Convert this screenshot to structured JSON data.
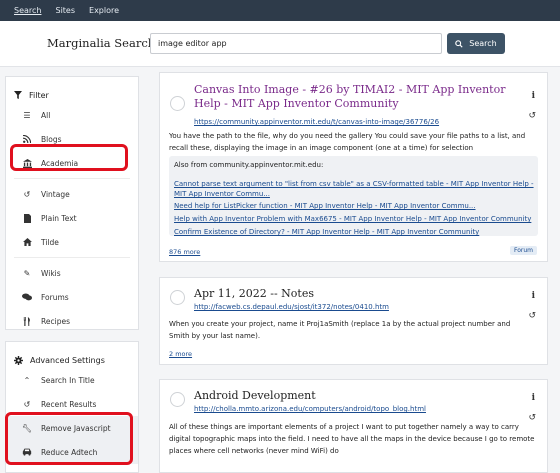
{
  "topnav": {
    "search": "Search",
    "sites": "Sites",
    "explore": "Explore"
  },
  "header": {
    "brand": "Marginalia Search",
    "query": "image editor app",
    "search_button": "Search"
  },
  "filter": {
    "title": "Filter",
    "items": [
      {
        "label": "All",
        "icon": "list-icon"
      },
      {
        "label": "Blogs",
        "icon": "rss-icon"
      },
      {
        "label": "Academia",
        "icon": "university-icon"
      },
      {
        "label": "Vintage",
        "icon": "history-icon"
      },
      {
        "label": "Plain Text",
        "icon": "file-icon"
      },
      {
        "label": "Tilde",
        "icon": "home-icon"
      },
      {
        "label": "Wikis",
        "icon": "pen-icon"
      },
      {
        "label": "Forums",
        "icon": "comments-icon"
      },
      {
        "label": "Recipes",
        "icon": "utensils-icon"
      }
    ]
  },
  "advanced": {
    "title": "Advanced Settings",
    "items": [
      {
        "label": "Search In Title",
        "icon": "caret-up-icon"
      },
      {
        "label": "Recent Results",
        "icon": "history-icon"
      },
      {
        "label": "Remove Javascript",
        "icon": "wrench-icon"
      },
      {
        "label": "Reduce Adtech",
        "icon": "car-icon"
      }
    ]
  },
  "results": [
    {
      "title": "Canvas Into Image - #26 by TIMAI2 - MIT App Inventor Help - MIT App Inventor Community",
      "url": "https://community.appinventor.mit.edu/t/canvas-into-image/36776/26",
      "description": "You have the path to the file, why do you need the gallery You could save your file paths to a list, and recall these, displaying the image in an image component (one at a time) for selection",
      "also_from": "Also from community.appinventor.mit.edu:",
      "also_links": [
        "Cannot parse text argument to \"list from csv table\" as a CSV-formatted table - MIT App Inventor Help - MIT App Inventor Commu...",
        "Need help for ListPicker function - MIT App Inventor Help - MIT App Inventor Commu...",
        "Help with App Inventor Problem with Max6675 - MIT App Inventor Help - MIT App Inventor Community",
        "Confirm Existence of Directory? - MIT App Inventor Help - MIT App Inventor Community"
      ],
      "more": "876 more",
      "tag": "Forum"
    },
    {
      "title": "Apr 11, 2022 -- Notes",
      "url": "http://facweb.cs.depaul.edu/sjost/it372/notes/0410.htm",
      "description": "When you create your project, name it Proj1aSmith (replace 1a by the actual project number and Smith by your last name).",
      "more": "2 more"
    },
    {
      "title": "Android Development",
      "url": "http://cholla.mmto.arizona.edu/computers/android/topo_blog.html",
      "description": "All of these things are important elements of a project I want to put together namely a way to carry digital topographic maps into the field. I need to have all the maps in the device because I go to remote places where cell networks (never mind WiFi) do"
    }
  ],
  "colors": {
    "nav_bg": "#2e3b4a",
    "button_bg": "#3d5366",
    "link": "#1a4b8f",
    "visited": "#7a2a8a",
    "highlight": "#e0101e"
  }
}
